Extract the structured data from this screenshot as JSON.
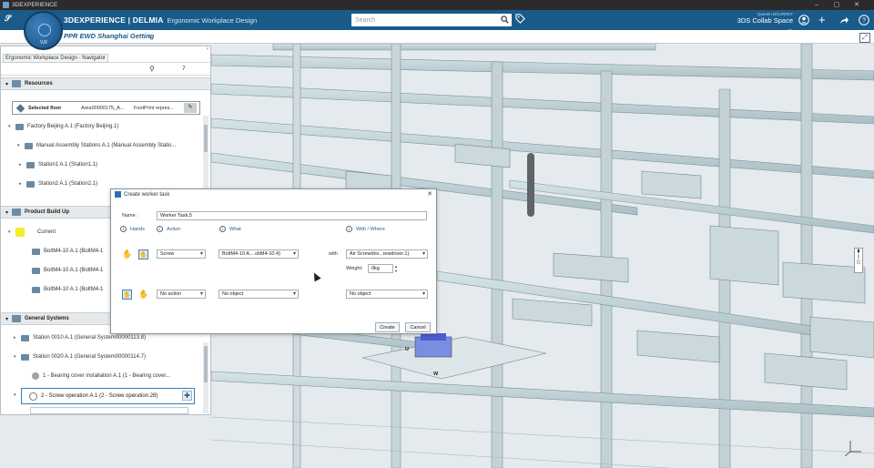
{
  "os_bar": {
    "title": "3DEXPERIENCE"
  },
  "app": {
    "brand": "3DEXPERIENCE | DELMIA",
    "brand_sub": "Ergonomic Workplace Design",
    "search_placeholder": "Search",
    "user_name": "Quentin BOURRET",
    "collab_space": "3DS Collab Space",
    "compass_label": "V,R"
  },
  "tab": {
    "label": "PPR EWD Shanghai Getting"
  },
  "navigator": {
    "title": "Ergonomic Workplace Design - Navigator",
    "tool_count": "7",
    "sections": {
      "resources": "Resources",
      "product_build_up": "Product Build Up",
      "general_systems": "General Systems"
    },
    "selected_floor": {
      "label": "Selected floor",
      "value": "Area00000175_A...",
      "footprint": "FootPrint repres..."
    },
    "resources_items": [
      "Factory Beijing A.1 (Factory Beijing.1)",
      "Manual Assembly Stations A.1 (Manual Assembly Statio...",
      "Station1 A.1 (Station1.1)",
      "Station2 A.1 (Station2.1)"
    ],
    "product_items": {
      "current": "Current",
      "bolts": [
        "BoltM4-10 A.1 (BoltM4-1",
        "BoltM4-10 A.1 (BoltM4-1",
        "BoltM4-10 A.1 (BoltM4-1"
      ]
    },
    "general_items": [
      "Station 0010 A.1 (General System00000113.8)",
      "Station 0020 A.1 (General System00000114.7)",
      "1 - Bearing cover installation A.1 (1 - Bearing cover...",
      "2 - Screw operation A.1 (2 - Screw operation.28)"
    ]
  },
  "dialog": {
    "title": "Create worker task",
    "name_label": "Name :",
    "name_value": "Worker Task.5",
    "headers": {
      "hands": "Hands",
      "action": "Action",
      "what": "What",
      "with_where": "With / Where"
    },
    "row1": {
      "action": "Screw",
      "what": "BoltM4-10 A....oltM4-10.4)",
      "with_label": "with",
      "with_value": "Air Screwdriv...rewdriver.1)",
      "weight_label": "Weight:",
      "weight_value": "0kg"
    },
    "row2": {
      "action": "No action",
      "what": "No object",
      "with_value": "No object"
    },
    "create_label": "Create",
    "cancel_label": "Cancel"
  },
  "viewport": {
    "label_u": "U",
    "label_w": "W"
  }
}
